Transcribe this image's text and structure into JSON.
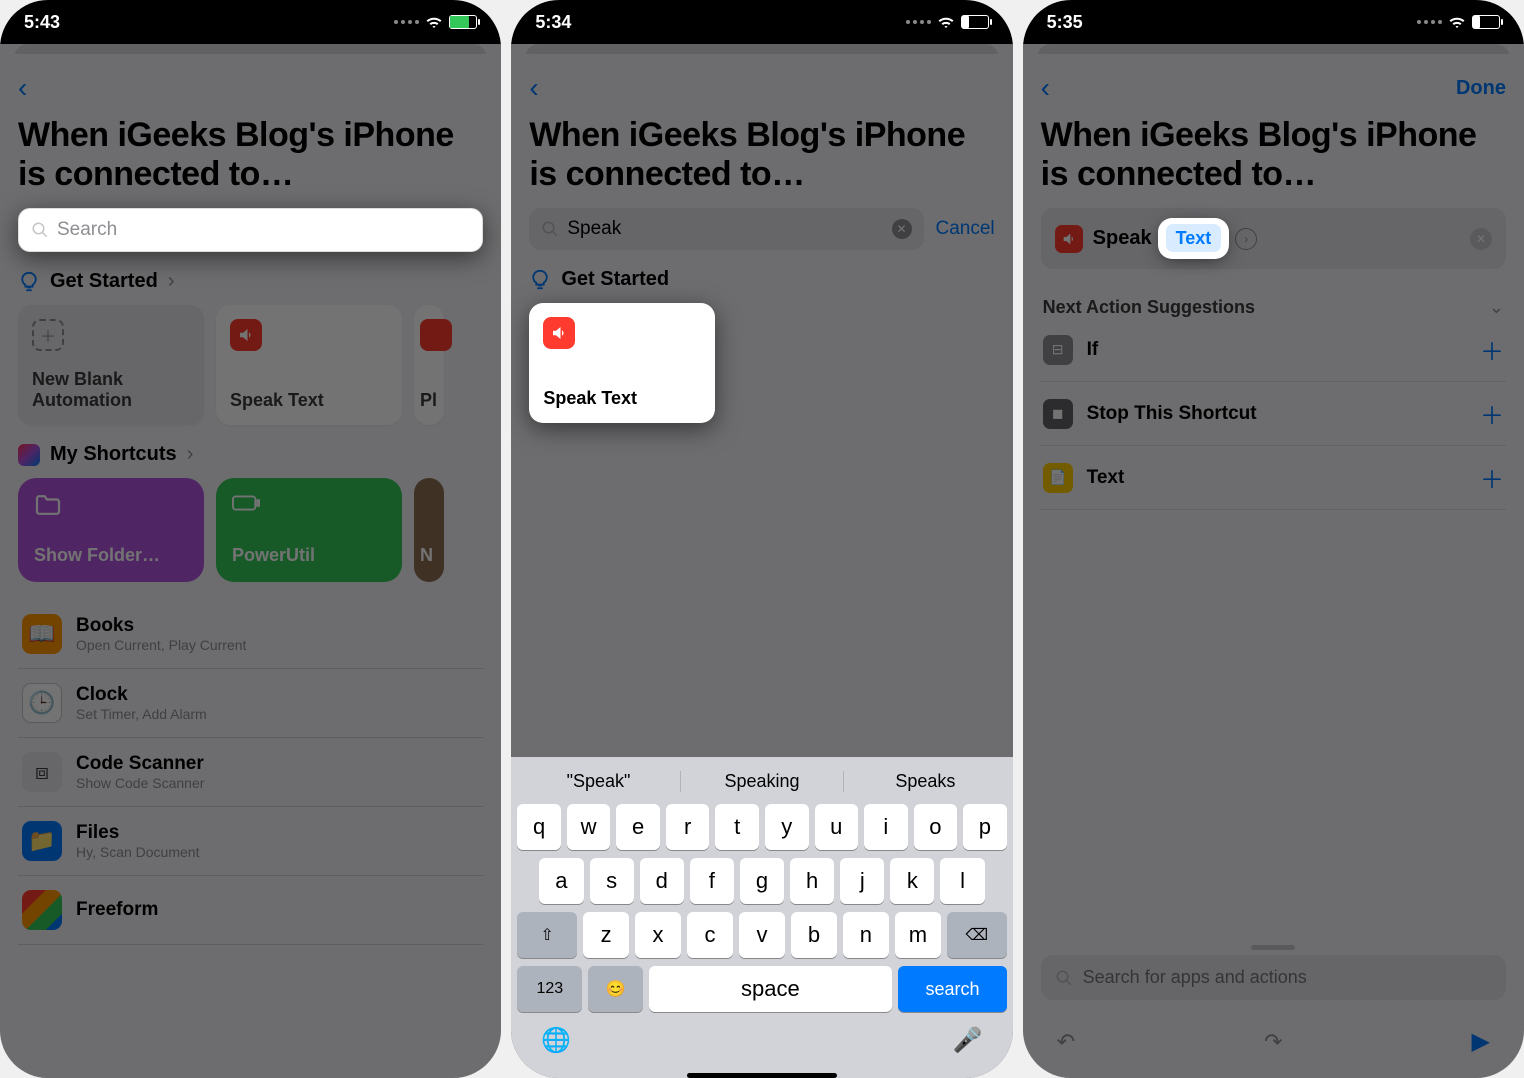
{
  "status": {
    "t1": "5:43",
    "t2": "5:34",
    "t3": "5:35"
  },
  "title": "When iGeeks Blog's iPhone is connected to…",
  "screen1": {
    "search_placeholder": "Search",
    "get_started": "Get Started",
    "cards": {
      "new_blank": "New Blank Automation",
      "speak_text": "Speak Text",
      "third_prefix": "Pl"
    },
    "my_shortcuts": "My Shortcuts",
    "big": {
      "folder": "Show Folder…",
      "power": "PowerUtil",
      "third_prefix": "N"
    },
    "apps": [
      {
        "name": "Books",
        "sub": "Open Current, Play Current"
      },
      {
        "name": "Clock",
        "sub": "Set Timer, Add Alarm"
      },
      {
        "name": "Code Scanner",
        "sub": "Show Code Scanner"
      },
      {
        "name": "Files",
        "sub": "Hy, Scan Document"
      },
      {
        "name": "Freeform",
        "sub": ""
      }
    ]
  },
  "screen2": {
    "query": "Speak",
    "cancel": "Cancel",
    "get_started": "Get Started",
    "result": "Speak Text",
    "suggest": [
      "\"Speak\"",
      "Speaking",
      "Speaks"
    ],
    "keys_r1": [
      "q",
      "w",
      "e",
      "r",
      "t",
      "y",
      "u",
      "i",
      "o",
      "p"
    ],
    "keys_r2": [
      "a",
      "s",
      "d",
      "f",
      "g",
      "h",
      "j",
      "k",
      "l"
    ],
    "keys_r3": [
      "z",
      "x",
      "c",
      "v",
      "b",
      "n",
      "m"
    ],
    "numkey": "123",
    "space": "space",
    "search": "search"
  },
  "screen3": {
    "done": "Done",
    "speak": "Speak",
    "token": "Text",
    "next_header": "Next Action Suggestions",
    "sugs": [
      {
        "name": "If"
      },
      {
        "name": "Stop This Shortcut"
      },
      {
        "name": "Text"
      }
    ],
    "search_placeholder": "Search for apps and actions"
  }
}
